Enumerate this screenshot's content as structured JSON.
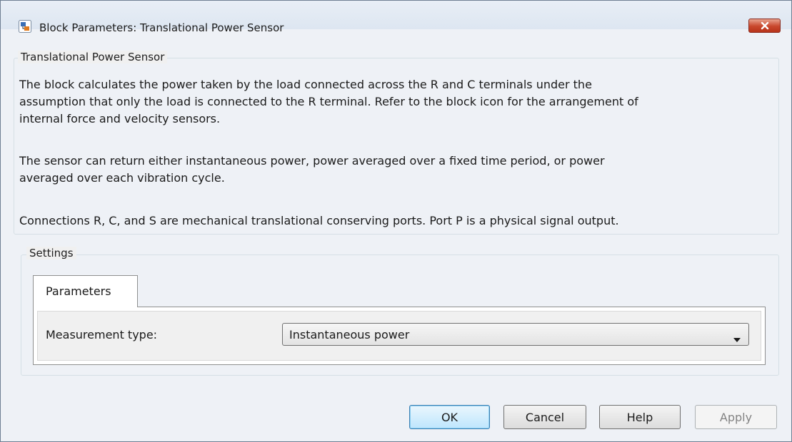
{
  "window": {
    "title": "Block Parameters: Translational Power Sensor",
    "icon": "simulink-block-icon",
    "close_icon": "close-icon"
  },
  "description_group": {
    "label": "Translational Power Sensor",
    "paragraph1_line1": "The block calculates the power taken by the load connected across the R and C terminals under the",
    "paragraph1_line2": "assumption that only the load is connected to the R terminal. Refer to the block icon for the arrangement of",
    "paragraph1_line3": "internal force and velocity sensors.",
    "paragraph2_line1": "The sensor can return either instantaneous power, power averaged over a fixed time period, or power",
    "paragraph2_line2": "averaged over each vibration cycle.",
    "paragraph3_line1": "Connections R, C, and S are mechanical translational conserving ports. Port P is a physical signal output."
  },
  "settings_group": {
    "label": "Settings",
    "tabs": [
      {
        "label": "Parameters",
        "active": true
      }
    ],
    "fields": [
      {
        "label": "Measurement type:",
        "value": "Instantaneous power",
        "control": "dropdown"
      }
    ]
  },
  "buttons": {
    "ok": "OK",
    "cancel": "Cancel",
    "help": "Help",
    "apply": "Apply"
  },
  "colors": {
    "close_button": "#c8472c",
    "default_button": "#bee6fd",
    "client_background": "#f0f0f0"
  }
}
